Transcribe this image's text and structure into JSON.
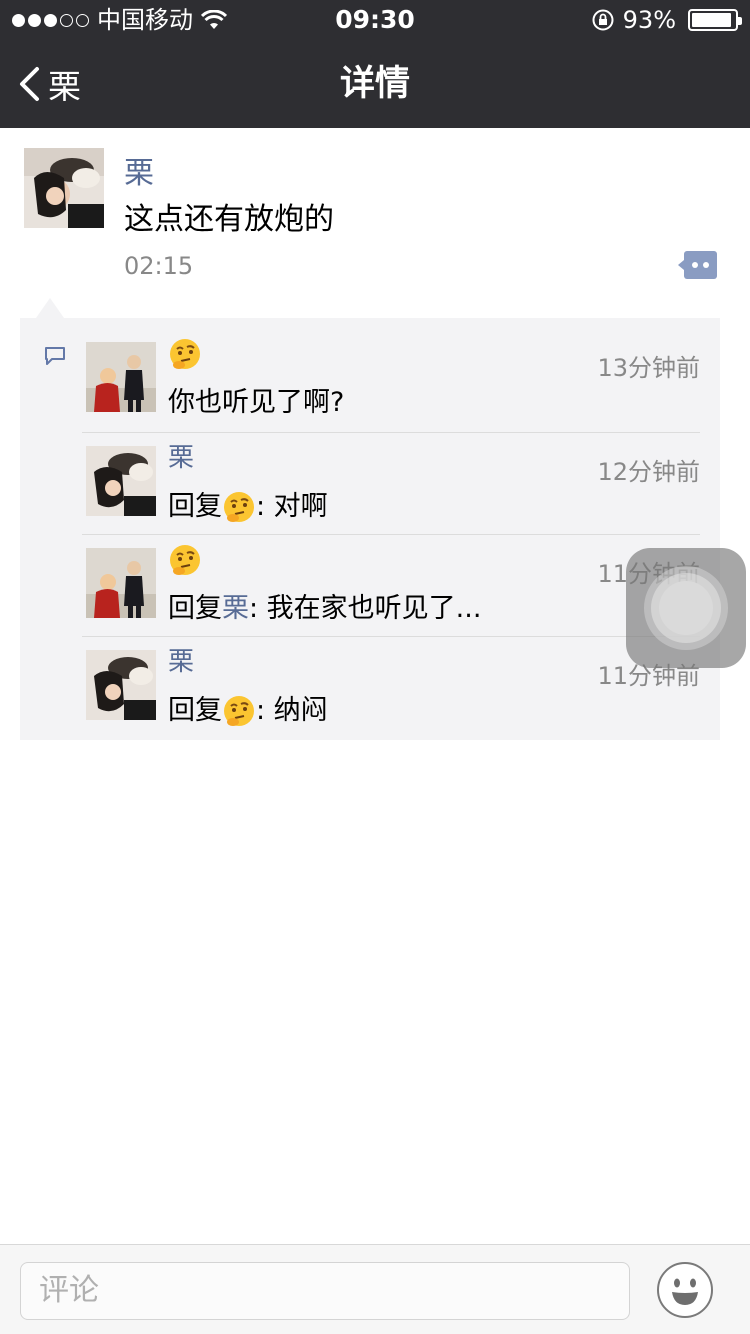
{
  "status_bar": {
    "carrier": "中国移动",
    "time": "09:30",
    "battery": "93%",
    "battery_level": 0.93
  },
  "nav": {
    "back_label": "栗",
    "title": "详情"
  },
  "post": {
    "author": "栗",
    "text": "这点还有放炮的",
    "time": "02:15"
  },
  "comments": [
    {
      "author_icon": "thinking-face-emoji",
      "time": "13分钟前",
      "text": "你也听见了啊?"
    },
    {
      "author": "栗",
      "time": "12分钟前",
      "reply_prefix": "回复",
      "reply_to_icon": "thinking-face-emoji",
      "text": ": 对啊"
    },
    {
      "author_icon": "thinking-face-emoji",
      "time": "11分钟前",
      "reply_prefix": "回复",
      "reply_to": "栗",
      "text": ": 我在家也听见了..."
    },
    {
      "author": "栗",
      "time": "11分钟前",
      "reply_prefix": "回复",
      "reply_to_icon": "thinking-face-emoji",
      "text": ": 纳闷"
    }
  ],
  "input": {
    "placeholder": "评论"
  },
  "colors": {
    "bar_bg": "#2e2e32",
    "link": "#576b95",
    "comments_bg": "#f3f3f5"
  }
}
